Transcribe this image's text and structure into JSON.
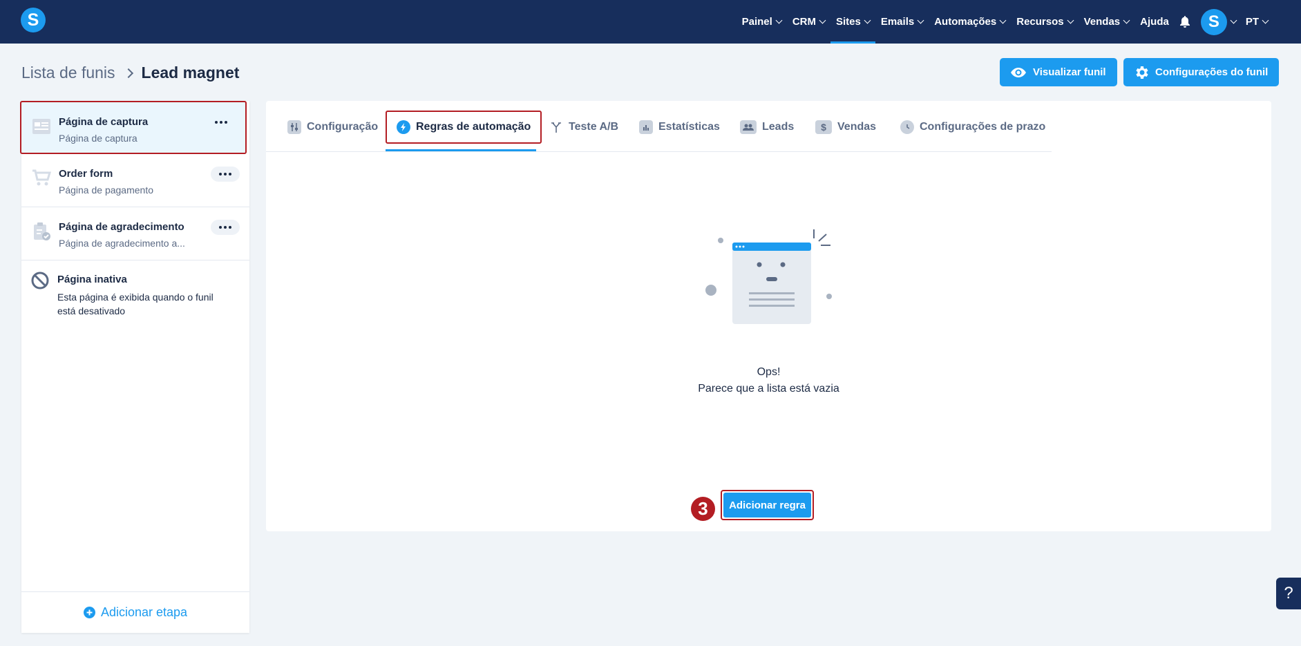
{
  "topnav": {
    "items": [
      {
        "label": "Painel",
        "has_menu": true
      },
      {
        "label": "CRM",
        "has_menu": true
      },
      {
        "label": "Sites",
        "has_menu": true,
        "active": true
      },
      {
        "label": "Emails",
        "has_menu": true
      },
      {
        "label": "Automações",
        "has_menu": true
      },
      {
        "label": "Recursos",
        "has_menu": true
      },
      {
        "label": "Vendas",
        "has_menu": true
      },
      {
        "label": "Ajuda",
        "has_menu": false
      }
    ],
    "logo_letter": "S",
    "avatar_letter": "S",
    "language": "PT"
  },
  "breadcrumb": {
    "parent": "Lista de funis",
    "current": "Lead magnet"
  },
  "header_actions": {
    "preview_label": "Visualizar funil",
    "settings_label": "Configurações do funil"
  },
  "sidebar": {
    "steps": [
      {
        "title": "Página de captura",
        "subtitle": "Página de captura",
        "icon": "capture-page-icon"
      },
      {
        "title": "Order form",
        "subtitle": "Página de pagamento",
        "icon": "cart-icon"
      },
      {
        "title": "Página de agradecimento",
        "subtitle": "Página de agradecimento a...",
        "icon": "clipboard-check-icon"
      }
    ],
    "inactive": {
      "title": "Página inativa",
      "description": "Esta página é exibida quando o funil está desativado"
    },
    "add_step_label": "Adicionar etapa"
  },
  "tabs": [
    {
      "label": "Configuração",
      "icon": "sliders-icon"
    },
    {
      "label": "Regras de automação",
      "icon": "lightning-icon",
      "active": true
    },
    {
      "label": "Teste A/B",
      "icon": "split-icon"
    },
    {
      "label": "Estatísticas",
      "icon": "bar-chart-icon"
    },
    {
      "label": "Leads",
      "icon": "users-icon"
    },
    {
      "label": "Vendas",
      "icon": "dollar-icon"
    },
    {
      "label": "Configurações de prazo",
      "icon": "clock-icon"
    }
  ],
  "empty_state": {
    "title": "Ops!",
    "subtitle": "Parece que a lista está vazia"
  },
  "add_rule_label": "Adicionar regra",
  "step_marker": "3",
  "help_label": "?",
  "colors": {
    "topbar": "#172e5c",
    "accent": "#1c9bef",
    "highlight": "#b31d23",
    "background": "#f0f4f8"
  }
}
